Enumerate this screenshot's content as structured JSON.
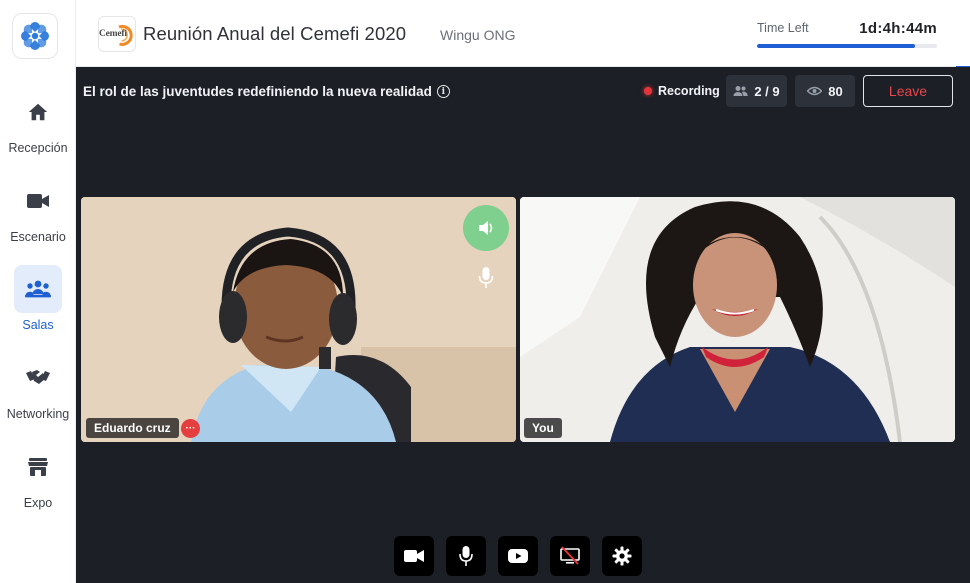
{
  "sidebar": {
    "items": [
      {
        "label": "Recepción",
        "icon": "home-icon",
        "active": false
      },
      {
        "label": "Escenario",
        "icon": "video-camera-icon",
        "active": false
      },
      {
        "label": "Salas",
        "icon": "group-icon",
        "active": true
      },
      {
        "label": "Networking",
        "icon": "handshake-icon",
        "active": false
      },
      {
        "label": "Expo",
        "icon": "store-icon",
        "active": false
      }
    ]
  },
  "header": {
    "logo_text": "Cemefi",
    "event_title": "Reunión Anual del Cemefi 2020",
    "organizer": "Wingu ONG",
    "time_left_label": "Time Left",
    "time_left_value": "1d:4h:44m",
    "time_progress": 0.88
  },
  "session": {
    "title": "El rol de las juventudes redefiniendo la nueva realidad",
    "recording_label": "Recording",
    "participants": "2 / 9",
    "viewers": "80",
    "leave_label": "Leave"
  },
  "participants": [
    {
      "name": "Eduardo cruz",
      "speaking": true,
      "more": "···"
    },
    {
      "name": "You"
    }
  ],
  "controls": [
    "camera-icon",
    "microphone-icon",
    "youtube-icon",
    "screen-share-off-icon",
    "settings-icon"
  ],
  "colors": {
    "accent": "#1f5fd6",
    "stage_bg": "#1c1f26",
    "recording": "#e5353a",
    "leave": "#e5484d",
    "speaking": "#7fcf8e"
  }
}
